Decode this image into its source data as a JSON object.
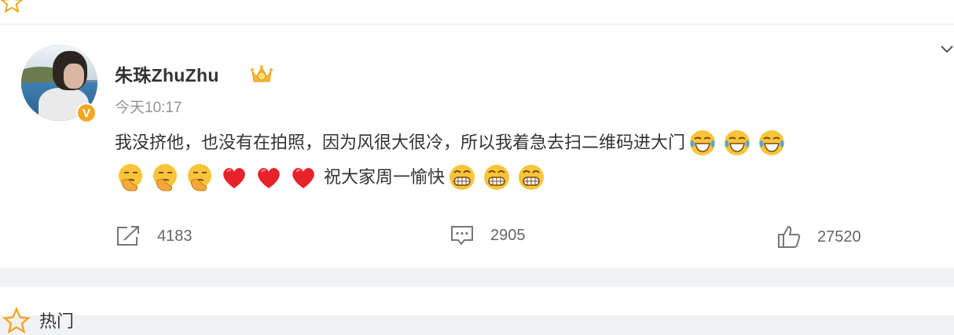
{
  "post": {
    "username": "朱珠ZhuZhu",
    "verified_badge": "V",
    "timestamp": "今天10:17",
    "text_line1": "我没挤他，也没有在拍照，因为风很大很冷，所以我着急去扫二维码进大门",
    "text_line2_middle": "祝大家周一愉快",
    "line1_trailing_emoji": [
      "laugh-cry-emoji",
      "laugh-cry-emoji",
      "laugh-cry-emoji"
    ],
    "line2_leading_emoji": [
      "thinking-emoji",
      "thinking-emoji",
      "thinking-emoji",
      "heart-emoji",
      "heart-emoji",
      "heart-emoji"
    ],
    "line2_trailing_emoji": [
      "grin-emoji",
      "grin-emoji",
      "grin-emoji"
    ]
  },
  "actions": {
    "repost_count": "4183",
    "comment_count": "2905",
    "like_count": "27520"
  },
  "bottom": {
    "label": "热门"
  },
  "colors": {
    "page_bg": "#f1f2f5",
    "card_bg": "#ffffff",
    "text": "#333333",
    "meta": "#939393",
    "heart": "#e8222b",
    "emoji_yellow": "#f8c53a",
    "badge": "#f5a623"
  }
}
